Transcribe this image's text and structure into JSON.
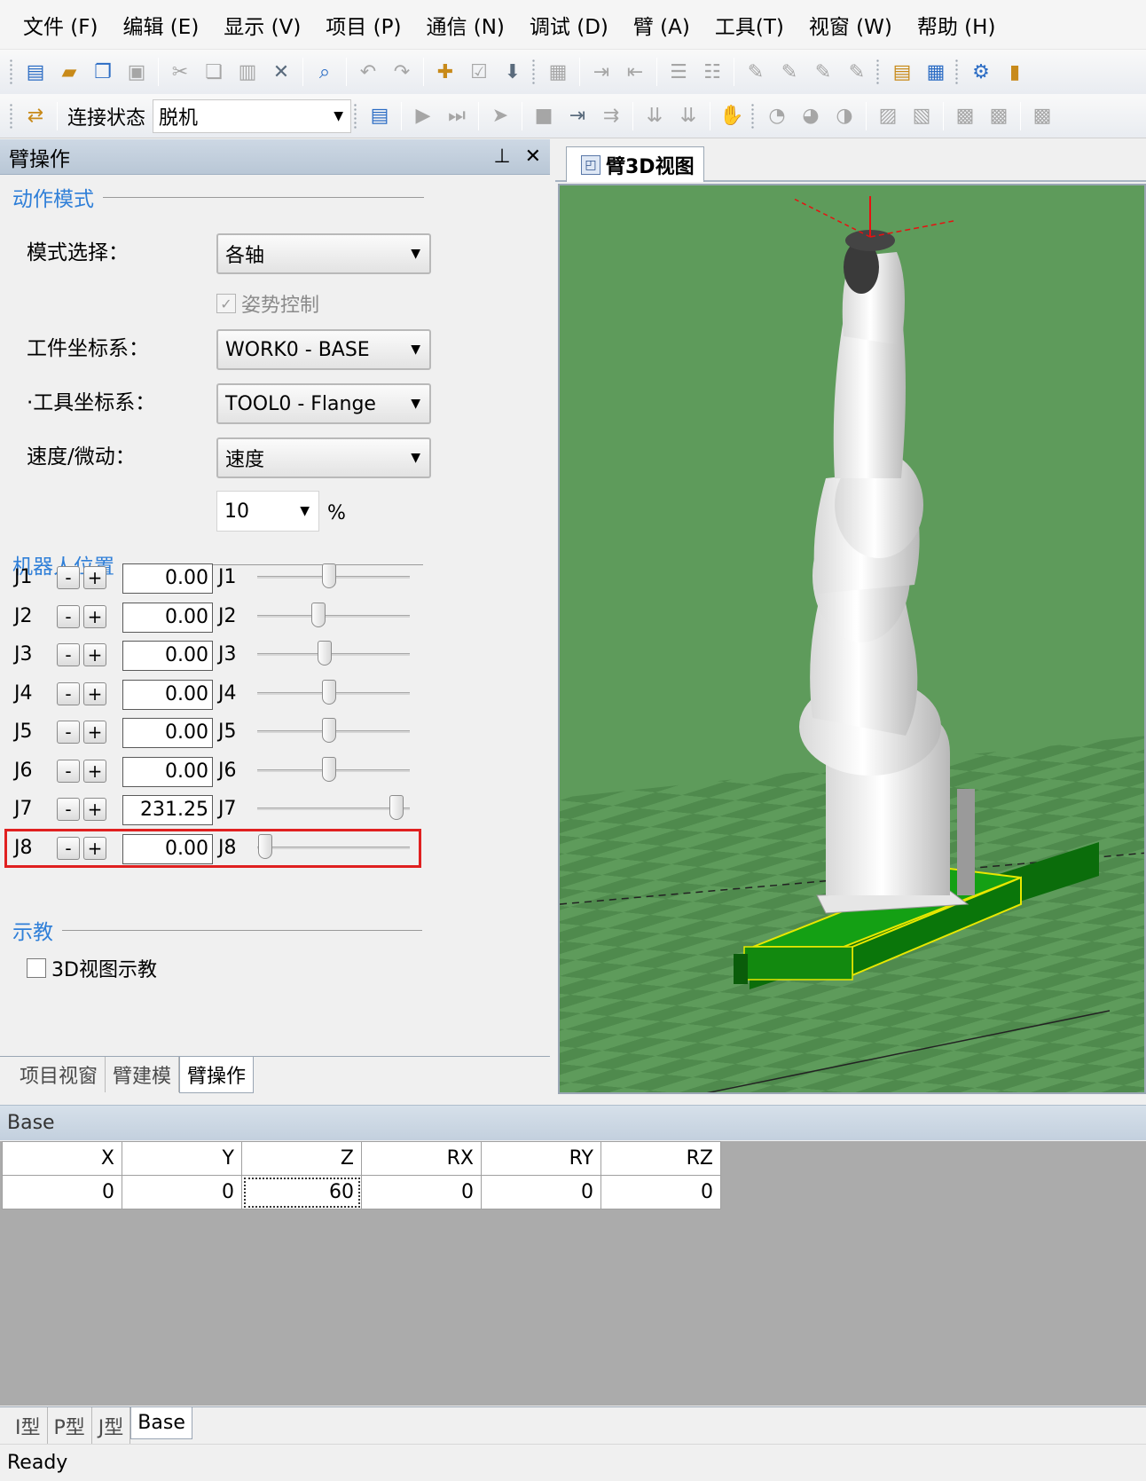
{
  "menu": [
    "文件 (F)",
    "编辑 (E)",
    "显示 (V)",
    "项目 (P)",
    "通信 (N)",
    "调试 (D)",
    "臂 (A)",
    "工具(T)",
    "视窗 (W)",
    "帮助 (H)"
  ],
  "toolbar2": {
    "conn_label": "连接状态",
    "conn_value": "脱机"
  },
  "panel": {
    "title": "臂操作",
    "pin_icon": "pin-icon",
    "close_icon": "close-icon",
    "action_mode": {
      "heading": "动作模式",
      "mode_label": "模式选择：",
      "mode_value": "各轴",
      "posture_label": "姿势控制",
      "posture_checked": true,
      "work_label": "工件坐标系：",
      "work_value": "WORK0 - BASE",
      "tool_label": "·工具坐标系：",
      "tool_value": "TOOL0 - Flange",
      "speed_label": "速度/微动：",
      "speed_value": "速度",
      "speed_pct": "10",
      "pct_unit": "%"
    },
    "robot_position": {
      "heading": "机器人位置",
      "minus": "-",
      "plus": "+",
      "joints": [
        {
          "name": "J1",
          "value": "0.00",
          "slider": 0.47
        },
        {
          "name": "J2",
          "value": "0.00",
          "slider": 0.4
        },
        {
          "name": "J3",
          "value": "0.00",
          "slider": 0.44
        },
        {
          "name": "J4",
          "value": "0.00",
          "slider": 0.47
        },
        {
          "name": "J5",
          "value": "0.00",
          "slider": 0.47
        },
        {
          "name": "J6",
          "value": "0.00",
          "slider": 0.47
        },
        {
          "name": "J7",
          "value": "231.25",
          "slider": 0.91
        },
        {
          "name": "J8",
          "value": "0.00",
          "slider": 0.05
        }
      ]
    },
    "teach": {
      "heading": "示教",
      "checkbox_label": "3D视图示教",
      "checked": false
    },
    "tabs": [
      "项目视窗",
      "臂建模",
      "臂操作"
    ],
    "active_tab": 2
  },
  "view3d": {
    "tab_label": "臂3D视图"
  },
  "base_grid": {
    "title": "Base",
    "columns": [
      "X",
      "Y",
      "Z",
      "RX",
      "RY",
      "RZ"
    ],
    "values": [
      "0",
      "0",
      "60",
      "0",
      "0",
      "0"
    ]
  },
  "bottom_tabs": [
    "I型",
    "P型",
    "J型",
    "Base"
  ],
  "status": "Ready",
  "colors": {
    "accent_blue": "#2f7fd8",
    "highlight_red": "#e02020",
    "view_bg": "#5e9b5b",
    "rail_green": "#108a10"
  }
}
